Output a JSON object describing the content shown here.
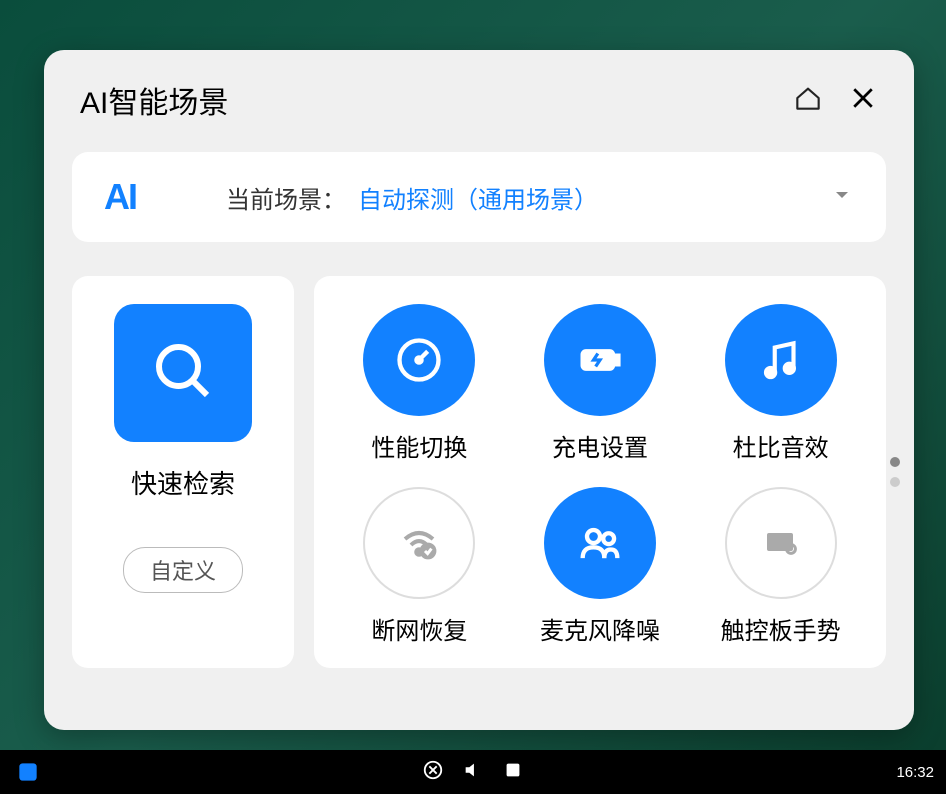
{
  "panel": {
    "title": "AI智能场景"
  },
  "scene": {
    "aiLogo": "AI",
    "label": "当前场景：",
    "value": "自动探测（通用场景）"
  },
  "quickSearch": {
    "label": "快速检索",
    "customButton": "自定义"
  },
  "gridItems": {
    "performance": "性能切换",
    "charging": "充电设置",
    "dolby": "杜比音效",
    "network": "断网恢复",
    "mic": "麦克风降噪",
    "touchpad": "触控板手势"
  },
  "taskbar": {
    "time": "16:32"
  }
}
